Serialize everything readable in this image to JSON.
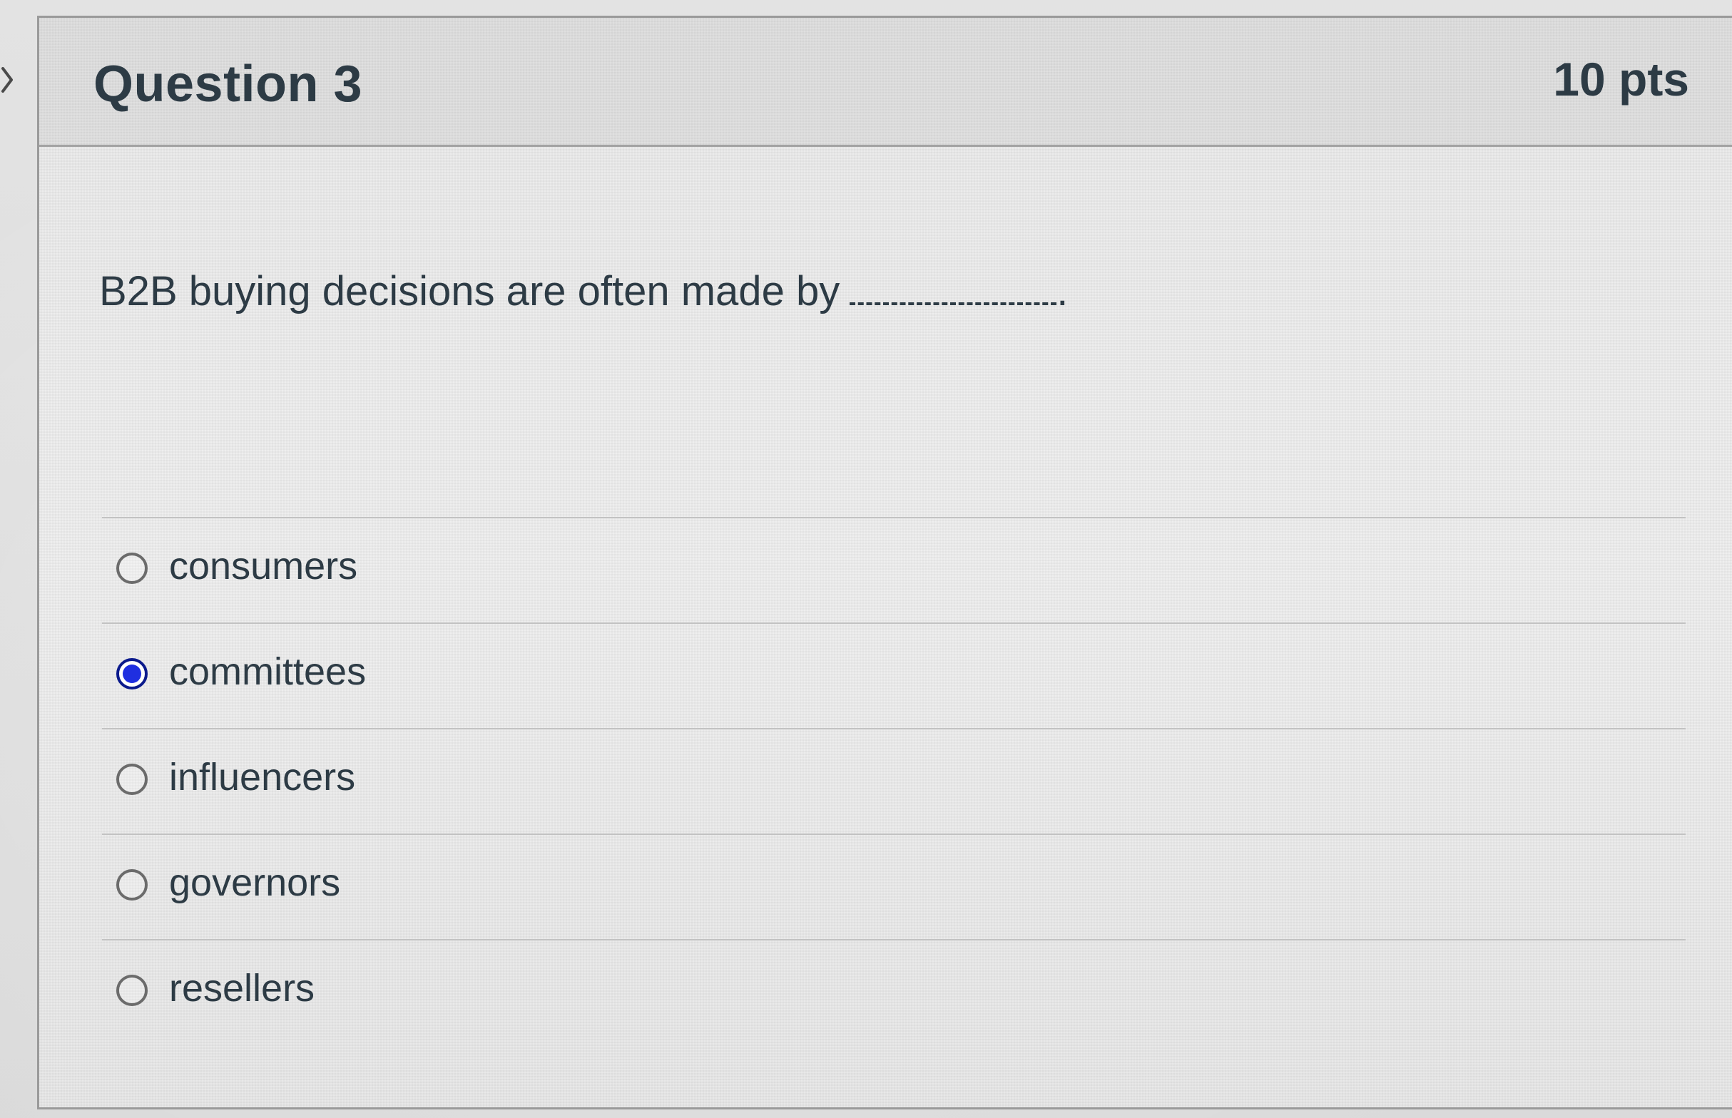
{
  "question": {
    "title": "Question 3",
    "points": "10 pts",
    "text": "B2B buying decisions are often made by",
    "blank_suffix": "."
  },
  "answers": [
    {
      "label": "consumers",
      "selected": false
    },
    {
      "label": "committees",
      "selected": true
    },
    {
      "label": "influencers",
      "selected": false
    },
    {
      "label": "governors",
      "selected": false
    },
    {
      "label": "resellers",
      "selected": false
    }
  ],
  "icons": {
    "side_nav": "chevron-right-icon",
    "radio_unselected": "radio-empty-icon",
    "radio_selected": "radio-filled-icon"
  },
  "colors": {
    "text": "#2d3b45",
    "radio_selected_fill": "#1f2fe0",
    "radio_selected_border": "#0b1a8c",
    "radio_border": "#6b6b6b",
    "divider": "#c2c2c2"
  }
}
